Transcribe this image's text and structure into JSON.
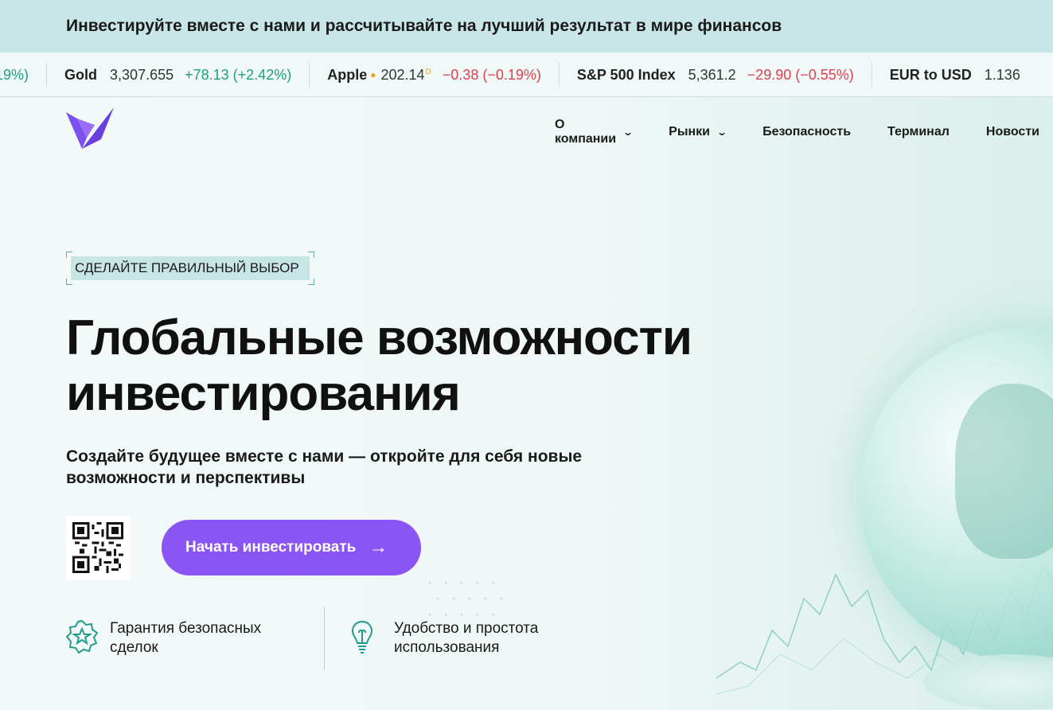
{
  "topbar": {
    "text": "Инвестируйте вместе с нами и рассчитывайте на лучший результат в мире финансов"
  },
  "ticker": {
    "lead_change": "19%)",
    "items": [
      {
        "name": "Gold",
        "price": "3,307.655",
        "change": "+78.13 (+2.42%)",
        "direction": "up"
      },
      {
        "name": "Apple",
        "price": "202.14",
        "sup": "D",
        "change": "−0.38 (−0.19%)",
        "direction": "down"
      },
      {
        "name": "S&P 500 Index",
        "price": "5,361.2",
        "change": "−29.90 (−0.55%)",
        "direction": "down"
      },
      {
        "name": "EUR to USD",
        "price": "1.136",
        "change": "",
        "direction": "none"
      }
    ]
  },
  "nav": {
    "items": [
      {
        "label": "О компании",
        "has_dropdown": true
      },
      {
        "label": "Рынки",
        "has_dropdown": true
      },
      {
        "label": "Безопасность",
        "has_dropdown": false
      },
      {
        "label": "Терминал",
        "has_dropdown": false
      },
      {
        "label": "Новости",
        "has_dropdown": false
      }
    ]
  },
  "hero": {
    "badge": "СДЕЛАЙТЕ ПРАВИЛЬНЫЙ ВЫБОР",
    "headline_line1": "Глобальные возможности",
    "headline_line2": "инвестирования",
    "subtitle": "Создайте будущее вместе с нами — откройте для себя новые возможности и перспективы",
    "cta_label": "Начать инвестировать",
    "cta_icon": "arrow-right-icon"
  },
  "features": [
    {
      "icon": "star-badge-icon",
      "text": "Гарантия безопасных сделок"
    },
    {
      "icon": "lightbulb-icon",
      "text": "Удобство и простота использования"
    }
  ],
  "colors": {
    "accent": "#8b55f5",
    "topbar_bg": "#c9e6e7",
    "up": "#1aa37a",
    "down": "#e0404a",
    "icon_teal": "#1f9c8e"
  }
}
